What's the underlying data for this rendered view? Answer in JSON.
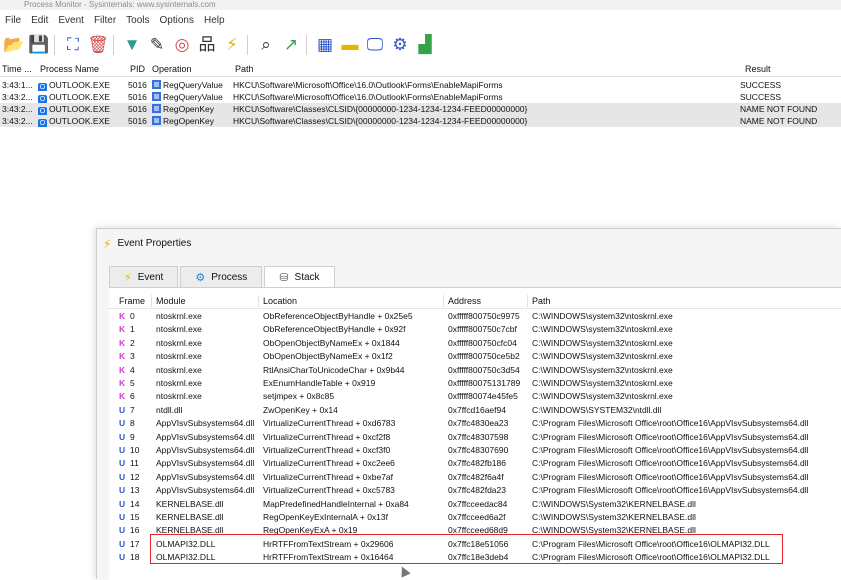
{
  "window": {
    "title": "Process Monitor - Sysinternals: www.sysinternals.com"
  },
  "menu": [
    "File",
    "Edit",
    "Event",
    "Filter",
    "Tools",
    "Options",
    "Help"
  ],
  "toolbar_icons": [
    {
      "name": "open-icon",
      "glyph": "📂",
      "color": "#c9a227"
    },
    {
      "name": "save-icon",
      "glyph": "💾",
      "color": "#3a6fd8"
    },
    {
      "name": "autoscroll-icon",
      "glyph": "⛶",
      "color": "#2b55c8"
    },
    {
      "name": "clear-icon",
      "glyph": "🗑",
      "color": "#d24b4b"
    },
    {
      "name": "filter-icon",
      "glyph": "▼",
      "color": "#2b9b8f"
    },
    {
      "name": "edit-filter-icon",
      "glyph": "✎",
      "color": "#333333"
    },
    {
      "name": "highlight-icon",
      "glyph": "◎",
      "color": "#d24b4b"
    },
    {
      "name": "process-tree-icon",
      "glyph": "品",
      "color": "#333333"
    },
    {
      "name": "event-properties-icon",
      "glyph": "⚡",
      "color": "#e8b400"
    },
    {
      "name": "find-icon",
      "glyph": "⌕",
      "color": "#333333"
    },
    {
      "name": "jump-icon",
      "glyph": "↗",
      "color": "#36a34a"
    },
    {
      "name": "registry-activity-icon",
      "glyph": "▦",
      "color": "#2b55c8"
    },
    {
      "name": "file-activity-icon",
      "glyph": "▬",
      "color": "#e8b400"
    },
    {
      "name": "network-activity-icon",
      "glyph": "🖵",
      "color": "#2b55c8"
    },
    {
      "name": "process-activity-icon",
      "glyph": "⚙",
      "color": "#2b55c8"
    },
    {
      "name": "profiling-icon",
      "glyph": "▟",
      "color": "#36a34a"
    }
  ],
  "events": {
    "columns": [
      "Time ...",
      "Process Name",
      "PID",
      "Operation",
      "Path",
      "Result"
    ],
    "rows": [
      {
        "time": "3:43:1...",
        "process": "OUTLOOK.EXE",
        "pid": "5016",
        "operation": "RegQueryValue",
        "path": "HKCU\\Software\\Microsoft\\Office\\16.0\\Outlook\\Forms\\EnableMapiForms",
        "result": "SUCCESS"
      },
      {
        "time": "3:43:2...",
        "process": "OUTLOOK.EXE",
        "pid": "5016",
        "operation": "RegQueryValue",
        "path": "HKCU\\Software\\Microsoft\\Office\\16.0\\Outlook\\Forms\\EnableMapiForms",
        "result": "SUCCESS"
      },
      {
        "time": "3:43:2...",
        "process": "OUTLOOK.EXE",
        "pid": "5016",
        "operation": "RegOpenKey",
        "path": "HKCU\\Software\\Classes\\CLSID\\{00000000-1234-1234-1234-FEED00000000}",
        "result": "NAME NOT FOUND"
      },
      {
        "time": "3:43:2...",
        "process": "OUTLOOK.EXE",
        "pid": "5016",
        "operation": "RegOpenKey",
        "path": "HKCU\\Software\\Classes\\CLSID\\{00000000-1234-1234-1234-FEED00000000}",
        "result": "NAME NOT FOUND"
      }
    ]
  },
  "dialog": {
    "title": "Event Properties",
    "tabs": [
      "Event",
      "Process",
      "Stack"
    ],
    "active_tab": "Stack",
    "stack": {
      "columns": [
        "Frame",
        "Module",
        "Location",
        "Address",
        "Path"
      ],
      "rows": [
        {
          "mode": "K",
          "frame": "0",
          "module": "ntoskrnl.exe",
          "location": "ObReferenceObjectByHandle + 0x25e5",
          "address": "0xfffff800750c9975",
          "path": "C:\\WINDOWS\\system32\\ntoskrnl.exe"
        },
        {
          "mode": "K",
          "frame": "1",
          "module": "ntoskrnl.exe",
          "location": "ObReferenceObjectByHandle + 0x92f",
          "address": "0xfffff800750c7cbf",
          "path": "C:\\WINDOWS\\system32\\ntoskrnl.exe"
        },
        {
          "mode": "K",
          "frame": "2",
          "module": "ntoskrnl.exe",
          "location": "ObOpenObjectByNameEx + 0x1844",
          "address": "0xfffff800750cfc04",
          "path": "C:\\WINDOWS\\system32\\ntoskrnl.exe"
        },
        {
          "mode": "K",
          "frame": "3",
          "module": "ntoskrnl.exe",
          "location": "ObOpenObjectByNameEx + 0x1f2",
          "address": "0xfffff800750ce5b2",
          "path": "C:\\WINDOWS\\system32\\ntoskrnl.exe"
        },
        {
          "mode": "K",
          "frame": "4",
          "module": "ntoskrnl.exe",
          "location": "RtlAnsiCharToUnicodeChar + 0x9b44",
          "address": "0xfffff800750c3d54",
          "path": "C:\\WINDOWS\\system32\\ntoskrnl.exe"
        },
        {
          "mode": "K",
          "frame": "5",
          "module": "ntoskrnl.exe",
          "location": "ExEnumHandleTable + 0x919",
          "address": "0xfffff80075131789",
          "path": "C:\\WINDOWS\\system32\\ntoskrnl.exe"
        },
        {
          "mode": "K",
          "frame": "6",
          "module": "ntoskrnl.exe",
          "location": "setjmpex + 0x8c85",
          "address": "0xfffff80074e45fe5",
          "path": "C:\\WINDOWS\\system32\\ntoskrnl.exe"
        },
        {
          "mode": "U",
          "frame": "7",
          "module": "ntdll.dll",
          "location": "ZwOpenKey + 0x14",
          "address": "0x7ffcd16aef94",
          "path": "C:\\WINDOWS\\SYSTEM32\\ntdll.dll"
        },
        {
          "mode": "U",
          "frame": "8",
          "module": "AppVIsvSubsystems64.dll",
          "location": "VirtualizeCurrentThread + 0xd6783",
          "address": "0x7ffc4830ea23",
          "path": "C:\\Program Files\\Microsoft Office\\root\\Office16\\AppVIsvSubsystems64.dll"
        },
        {
          "mode": "U",
          "frame": "9",
          "module": "AppVIsvSubsystems64.dll",
          "location": "VirtualizeCurrentThread + 0xcf2f8",
          "address": "0x7ffc48307598",
          "path": "C:\\Program Files\\Microsoft Office\\root\\Office16\\AppVIsvSubsystems64.dll"
        },
        {
          "mode": "U",
          "frame": "10",
          "module": "AppVIsvSubsystems64.dll",
          "location": "VirtualizeCurrentThread + 0xcf3f0",
          "address": "0x7ffc48307690",
          "path": "C:\\Program Files\\Microsoft Office\\root\\Office16\\AppVIsvSubsystems64.dll"
        },
        {
          "mode": "U",
          "frame": "11",
          "module": "AppVIsvSubsystems64.dll",
          "location": "VirtualizeCurrentThread + 0xc2ee6",
          "address": "0x7ffc482fb186",
          "path": "C:\\Program Files\\Microsoft Office\\root\\Office16\\AppVIsvSubsystems64.dll"
        },
        {
          "mode": "U",
          "frame": "12",
          "module": "AppVIsvSubsystems64.dll",
          "location": "VirtualizeCurrentThread + 0xbe7af",
          "address": "0x7ffc482f6a4f",
          "path": "C:\\Program Files\\Microsoft Office\\root\\Office16\\AppVIsvSubsystems64.dll"
        },
        {
          "mode": "U",
          "frame": "13",
          "module": "AppVIsvSubsystems64.dll",
          "location": "VirtualizeCurrentThread + 0xc5783",
          "address": "0x7ffc482fda23",
          "path": "C:\\Program Files\\Microsoft Office\\root\\Office16\\AppVIsvSubsystems64.dll"
        },
        {
          "mode": "U",
          "frame": "14",
          "module": "KERNELBASE.dll",
          "location": "MapPredefinedHandleInternal + 0xa84",
          "address": "0x7ffcceedac84",
          "path": "C:\\WINDOWS\\System32\\KERNELBASE.dll"
        },
        {
          "mode": "U",
          "frame": "15",
          "module": "KERNELBASE.dll",
          "location": "RegOpenKeyExInternalA + 0x13f",
          "address": "0x7ffcceed6a2f",
          "path": "C:\\WINDOWS\\System32\\KERNELBASE.dll"
        },
        {
          "mode": "U",
          "frame": "16",
          "module": "KERNELBASE.dll",
          "location": "RegOpenKeyExA + 0x19",
          "address": "0x7ffcceed68d9",
          "path": "C:\\WINDOWS\\System32\\KERNELBASE.dll"
        },
        {
          "mode": "U",
          "frame": "17",
          "module": "OLMAPI32.DLL",
          "location": "HrRTFFromTextStream + 0x29606",
          "address": "0x7ffc18e51056",
          "path": "C:\\Program Files\\Microsoft Office\\root\\Office16\\OLMAPI32.DLL"
        },
        {
          "mode": "U",
          "frame": "18",
          "module": "OLMAPI32.DLL",
          "location": "HrRTFFromTextStream + 0x16464",
          "address": "0x7ffc18e3deb4",
          "path": "C:\\Program Files\\Microsoft Office\\root\\Office16\\OLMAPI32.DLL"
        }
      ]
    }
  },
  "colors": {
    "kernel_mode": "#d63bd6",
    "user_mode": "#2b55c8",
    "highlight_border": "#e0262c"
  }
}
